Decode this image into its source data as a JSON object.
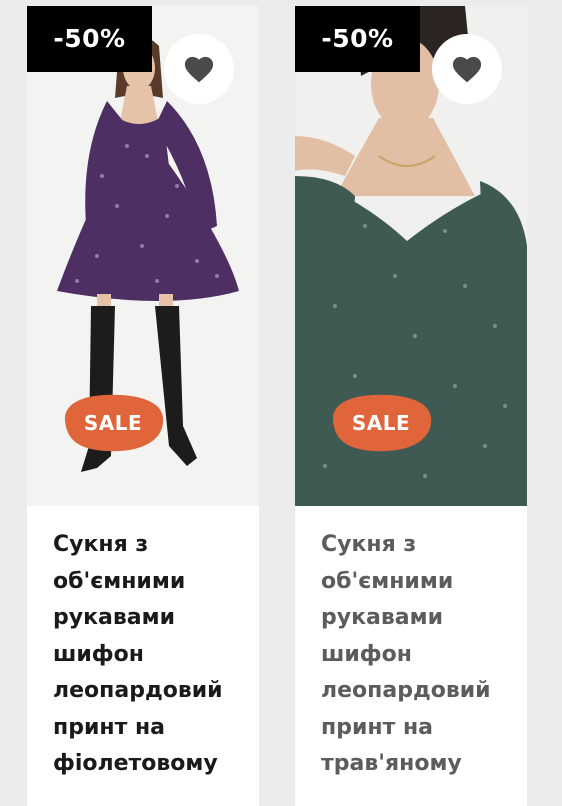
{
  "products": [
    {
      "discount": "-50%",
      "badge": "SALE",
      "favorite_icon": "heart-icon",
      "title": "Сукня з\nоб'ємними\nрукавами\nшифон\nлеопардовий\nпринт на\nфіолетовому",
      "dress_color": "#4e2f63"
    },
    {
      "discount": "-50%",
      "badge": "SALE",
      "favorite_icon": "heart-icon",
      "title": "Сукня з\nоб'ємними\nрукавами\nшифон\nлеопардовий\nпринт на\nтрав'яному",
      "dress_color": "#3f5a52"
    }
  ],
  "colors": {
    "discount_bg": "#000000",
    "sale_badge": "#e0653a",
    "heart": "#4a4a4a"
  }
}
